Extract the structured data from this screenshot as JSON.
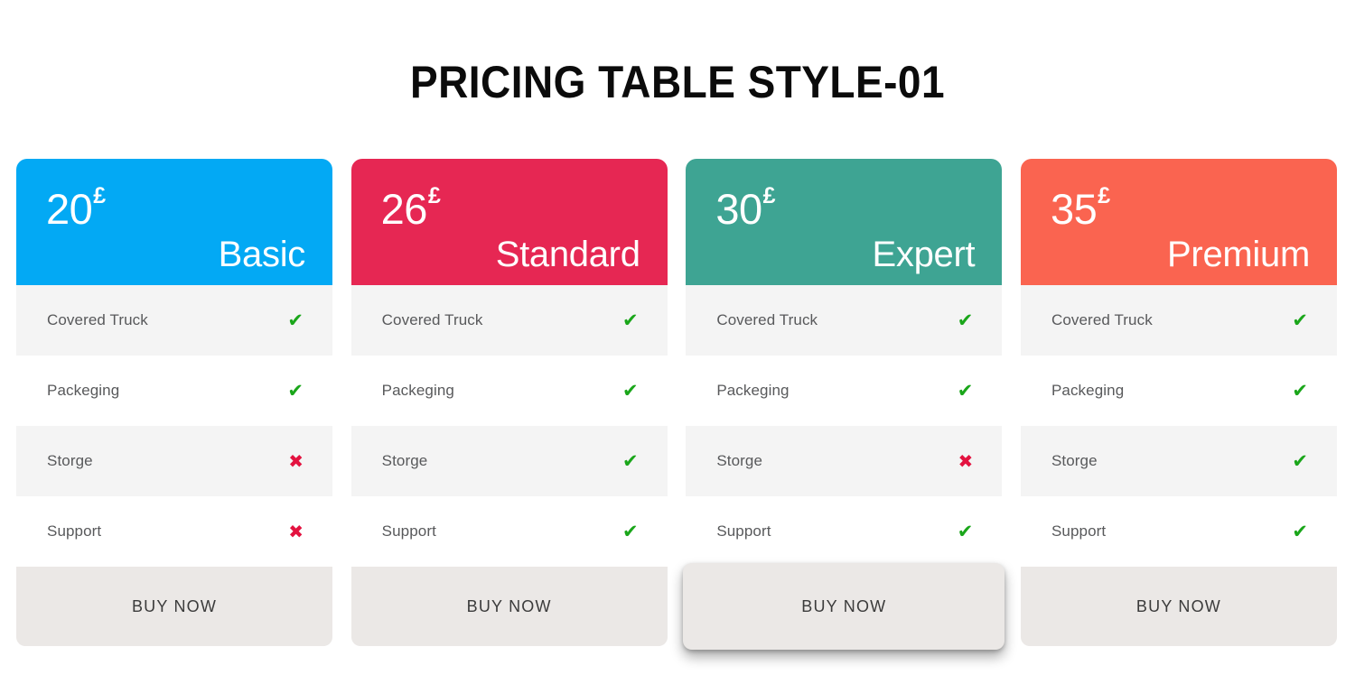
{
  "page": {
    "title": "PRICING TABLE STYLE-01",
    "background": "#ffffff"
  },
  "icons": {
    "check": "✔",
    "cross": "✖",
    "check_name": "check-icon",
    "cross_name": "cross-icon"
  },
  "colors": {
    "basic": "#03A9F4",
    "standard": "#E8data",
    "row_shaded": "#f4f4f4",
    "row_plain": "#ffffff",
    "button_band": "#ebe8e6",
    "check_green": "#1aa61a",
    "cross_red": "#e3123f",
    "label_gray": "#58595b"
  },
  "plans": [
    {
      "name": "Basic",
      "price": "20",
      "currency": "£",
      "header_color": "#03A9F4",
      "raised": false,
      "buy_label": "BUY NOW",
      "features": [
        {
          "label": "Covered Truck",
          "included": true
        },
        {
          "label": "Packeging",
          "included": true
        },
        {
          "label": "Storge",
          "included": false
        },
        {
          "label": "Support",
          "included": false
        }
      ]
    },
    {
      "name": "Standard",
      "price": "26",
      "currency": "£",
      "header_color": "#E62753",
      "raised": false,
      "buy_label": "BUY NOW",
      "features": [
        {
          "label": "Covered Truck",
          "included": true
        },
        {
          "label": "Packeging",
          "included": true
        },
        {
          "label": "Storge",
          "included": true
        },
        {
          "label": "Support",
          "included": true
        }
      ]
    },
    {
      "name": "Expert",
      "price": "30",
      "currency": "£",
      "header_color": "#3EA493",
      "raised": true,
      "buy_label": "BUY NOW",
      "features": [
        {
          "label": "Covered Truck",
          "included": true
        },
        {
          "label": "Packeging",
          "included": true
        },
        {
          "label": "Storge",
          "included": false
        },
        {
          "label": "Support",
          "included": true
        }
      ]
    },
    {
      "name": "Premium",
      "price": "35",
      "currency": "£",
      "header_color": "#FA6450",
      "raised": false,
      "buy_label": "BUY NOW",
      "features": [
        {
          "label": "Covered Truck",
          "included": true
        },
        {
          "label": "Packeging",
          "included": true
        },
        {
          "label": "Storge",
          "included": true
        },
        {
          "label": "Support",
          "included": true
        }
      ]
    }
  ]
}
